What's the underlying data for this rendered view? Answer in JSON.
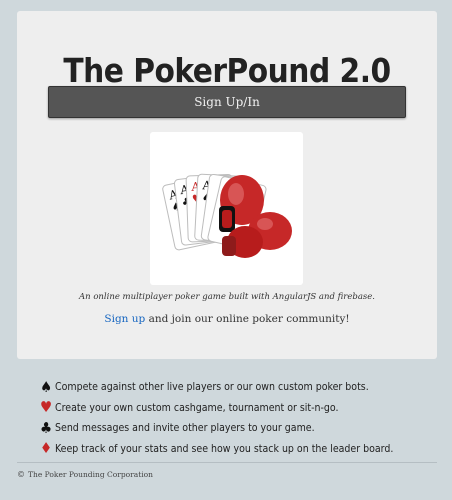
{
  "header": {
    "title": "The PokerPound 2.0",
    "signup_button": "Sign Up/In"
  },
  "hero": {
    "alt": "Poker cards and red boxing gloves"
  },
  "intro": {
    "tagline": "An online multiplayer poker game built with AngularJS and firebase.",
    "signup_link": "Sign up",
    "signup_rest": " and join our online poker community!"
  },
  "features": [
    {
      "icon": "spade-icon",
      "color": "#111111",
      "text": "Compete against other live players or our own custom poker bots."
    },
    {
      "icon": "heart-icon",
      "color": "#c62828",
      "text": "Create your own custom cashgame, tournament or sit-n-go."
    },
    {
      "icon": "club-icon",
      "color": "#111111",
      "text": "Send messages and invite other players to your game."
    },
    {
      "icon": "diamond-icon",
      "color": "#c62828",
      "text": "Keep track of your stats and see how you stack up on the leader board."
    }
  ],
  "footer": {
    "copyright_symbol": "©",
    "text": "The Poker Pounding Corporation"
  }
}
